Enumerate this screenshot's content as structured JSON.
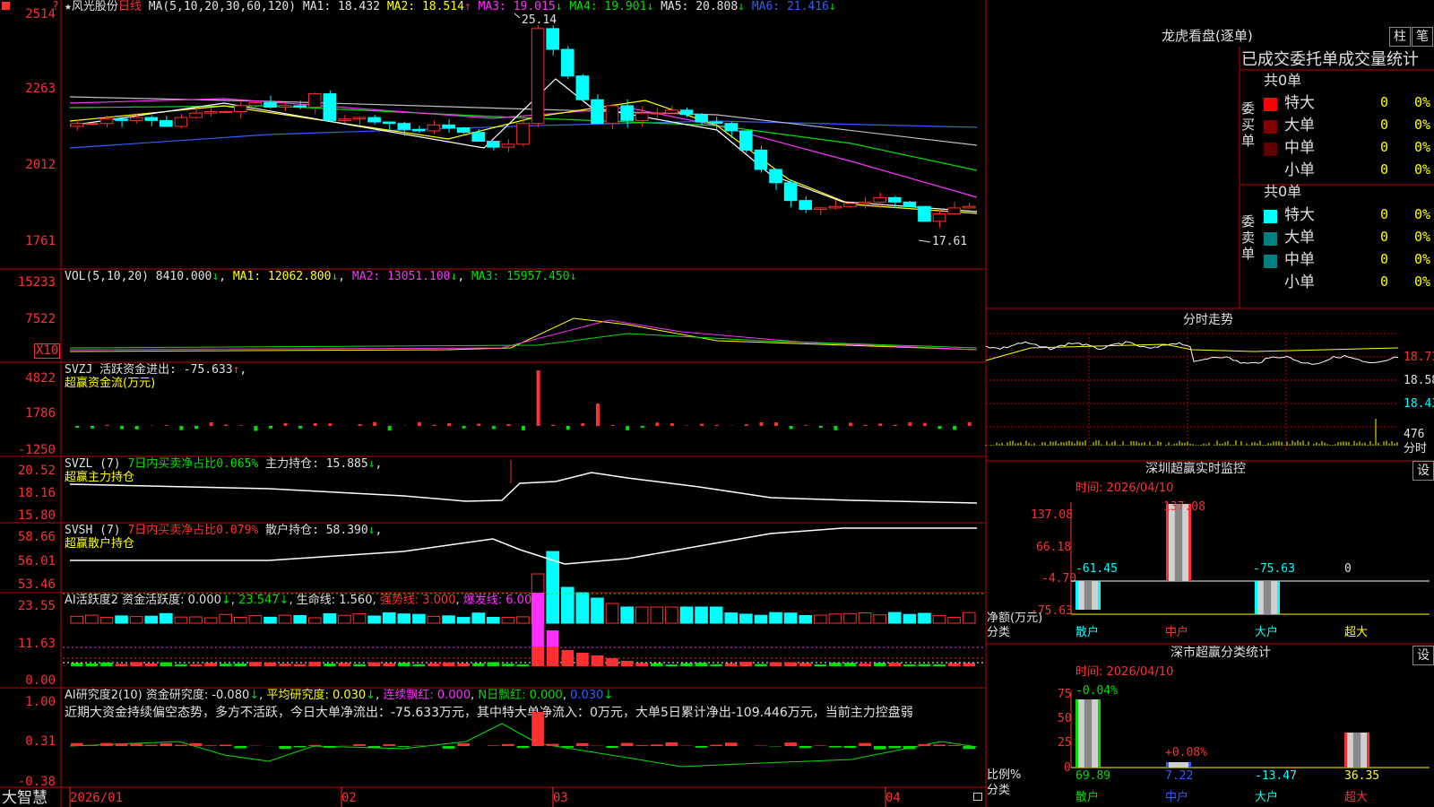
{
  "colors": {
    "up": "#ff3030",
    "down": "#00ffff",
    "ma1": "#ffffff",
    "ma2": "#ffff00",
    "ma3": "#ff30ff",
    "ma4": "#00e000",
    "ma5": "#c0c0c0",
    "ma6": "#3060ff",
    "border": "#c00000"
  },
  "corner_icon": "square-marker-icon",
  "kline": {
    "star": "★",
    "name": "风光股份",
    "period": "日线",
    "ma_params": "MA(5,10,20,30,60,120)",
    "ma1": "MA1: 18.432",
    "ma2": "MA2: 18.514",
    "ma3": "MA3: 19.015",
    "ma4": "MA4: 19.901",
    "ma5": "MA5: 20.808",
    "ma6": "MA6: 21.416",
    "up_arrow": "↑",
    "down_arrow": "↓",
    "high_label": "25.14",
    "low_label": "17.61",
    "y_ticks": [
      "2514",
      "2263",
      "2012",
      "1761"
    ]
  },
  "vol": {
    "label": "VOL(5,10,20)",
    "value": "8410.000",
    "ma1": "MA1: 12062.800",
    "ma2": "MA2: 13051.100",
    "ma3": "MA3: 15957.450",
    "y_ticks": [
      "15233",
      "7522"
    ],
    "unit": "X10"
  },
  "svzj": {
    "label": "SVZJ  活跃资金进出: -75.633",
    "sub": "超赢资金流(万元)",
    "comma": ",",
    "y_ticks": [
      "4822",
      "1786",
      "-1250"
    ]
  },
  "svzl": {
    "label": "SVZL (7)",
    "mid": "7日内买卖净占比0.065%",
    "tail": "主力持仓: 15.885",
    "sub": "超赢主力持仓",
    "y_ticks": [
      "20.52",
      "18.16",
      "15.80"
    ]
  },
  "svsh": {
    "label": "SVSH (7)",
    "mid": "7日内买卖净占比0.079%",
    "tail": "散户持仓: 58.390",
    "sub": "超赢散户持仓",
    "y_ticks": [
      "58.66",
      "56.01",
      "53.46"
    ]
  },
  "ai1": {
    "label": "AI活跃度2 资金活跃度: 0.000",
    "v2": "23.547",
    "v3": "生命线: 1.560",
    "v4": "强势线: 3.000",
    "v5": "爆发线: 6.000",
    "comma": ",",
    "y_ticks": [
      "23.55",
      "11.63",
      "0.00"
    ]
  },
  "ai2": {
    "label": "AI研究度2(10) 资金研究度: -0.080",
    "v2": "平均研究度: 0.030",
    "v3": "连续飘红: 0.000",
    "v4": "N日飘红: 0.000",
    "v5": "0.030",
    "comment": "近期大资金持续偏空态势，多方不活跃，今日大单净流出：-75.633万元，其中特大单净流入：0万元，大单5日累计净出-109.446万元，当前主力控盘弱",
    "y_ticks": [
      "1.00",
      "0.31",
      "-0.38"
    ]
  },
  "xaxis": {
    "brand": "大智慧",
    "labels": [
      "2026/01",
      "02",
      "03",
      "04"
    ]
  },
  "lhb": {
    "title": "龙虎看盘(逐单)",
    "btn1": "柱",
    "btn2": "笔",
    "table_title": "已成交委托单成交量统计",
    "buy_label": "委买单",
    "sell_label": "委卖单",
    "buy_total": "共0单",
    "sell_total": "共0单",
    "rows": [
      {
        "name": "特大",
        "val": "0",
        "pct": "0%"
      },
      {
        "name": "大单",
        "val": "0",
        "pct": "0%"
      },
      {
        "name": "中单",
        "val": "0",
        "pct": "0%"
      },
      {
        "name": "小单",
        "val": "0",
        "pct": "0%"
      }
    ]
  },
  "intraday": {
    "title": "分时走势",
    "y_ticks": [
      "18.73",
      "18.58",
      "18.43"
    ],
    "vol_value": "476",
    "vol_label": "分时"
  },
  "monitor": {
    "title": "深圳超赢实时监控",
    "btn": "设",
    "time": "时间: 2026/04/10",
    "y_ticks": [
      "137.08",
      "66.18",
      "-4.70",
      "-75.63"
    ],
    "y_label": "净额(万元)",
    "x_label": "分类",
    "categories": [
      "散户",
      "中户",
      "大户",
      "超大"
    ],
    "values": [
      "-61.45",
      "137.08",
      "-75.63",
      "0"
    ]
  },
  "classify": {
    "title": "深市超赢分类统计",
    "btn": "设",
    "time": "时间: 2026/04/10",
    "y_ticks": [
      "75",
      "50",
      "25",
      "0"
    ],
    "y_label": "比例%",
    "x_label": "分类",
    "categories": [
      "散户",
      "中户",
      "大户",
      "超大"
    ],
    "top_labels": [
      "-0.04%",
      "+0.08%",
      "",
      ""
    ],
    "values": [
      "69.89",
      "7.22",
      "-13.47",
      "36.35"
    ]
  }
}
